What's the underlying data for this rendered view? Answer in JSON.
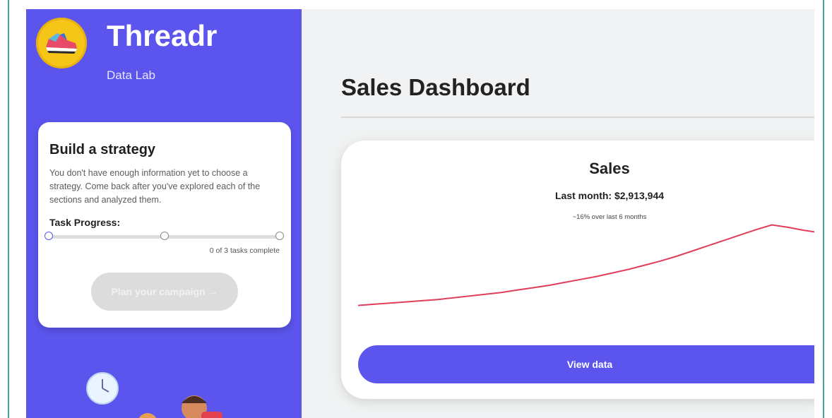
{
  "brand": {
    "name": "Threadr",
    "subtitle": "Data Lab"
  },
  "strategy_card": {
    "title": "Build a strategy",
    "description": "You don't have enough information yet to choose a strategy. Come back after you've explored each of the sections and analyzed them.",
    "progress_label": "Task Progress:",
    "tasks_complete": "0 of 3 tasks complete",
    "progress_fraction": 0,
    "plan_button": "Plan your campaign →"
  },
  "main": {
    "title": "Sales Dashboard",
    "sales_card": {
      "title": "Sales",
      "last_month": "Last month: $2,913,944",
      "change": "~16% over last 6 months",
      "view_button": "View data"
    }
  },
  "colors": {
    "brand": "#5b55ee",
    "line": "#e23c5b",
    "accent_teal": "#3fa89a"
  },
  "chart_data": {
    "type": "line",
    "series": [
      {
        "values": [
          100,
          102,
          104,
          106,
          108,
          110,
          113,
          116,
          119,
          122,
          126,
          130,
          134,
          139,
          144,
          149,
          155,
          161,
          168,
          175,
          183,
          192,
          201,
          210,
          219,
          228,
          236,
          232,
          227,
          223,
          218
        ]
      }
    ]
  }
}
